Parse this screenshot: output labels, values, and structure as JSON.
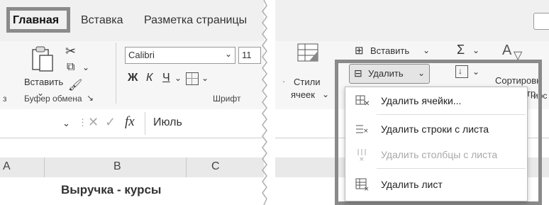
{
  "left": {
    "tabs": [
      {
        "label": "Главная",
        "active": true
      },
      {
        "label": "Вставка",
        "active": false
      },
      {
        "label": "Разметка страницы",
        "active": false
      }
    ],
    "paste_label": "Вставить",
    "font_name": "Calibri",
    "font_size": "11",
    "bold_label": "Ж",
    "italic_label": "К",
    "underline_label": "Ч",
    "clipboard_group": "Буфер обмена",
    "font_group": "Шрифт",
    "cell_prefix": "з",
    "fx_label": "fx",
    "formula_value": "Июль",
    "columns": [
      "A",
      "B",
      "C"
    ],
    "cell_b1": "Выручка - курсы"
  },
  "right": {
    "styles_label": "Стили",
    "styles_label2": "ячеек",
    "insert_label": "Вставить",
    "delete_label": "Удалить",
    "sort_label": "Сортировк",
    "sort_label2": "тр",
    "menu_items": [
      {
        "label": "Удалить ячейки...",
        "disabled": false
      },
      {
        "label": "Удалить строки с листа",
        "disabled": false
      },
      {
        "label": "Удалить столбцы с листа",
        "disabled": true
      },
      {
        "label": "Удалить лист",
        "disabled": false
      }
    ],
    "ribbon_fragment": "ирс",
    "colors": {
      "highlight": "#8a8a8a",
      "ribbon": "#f6f6f6",
      "menu": "#ffffff"
    }
  }
}
